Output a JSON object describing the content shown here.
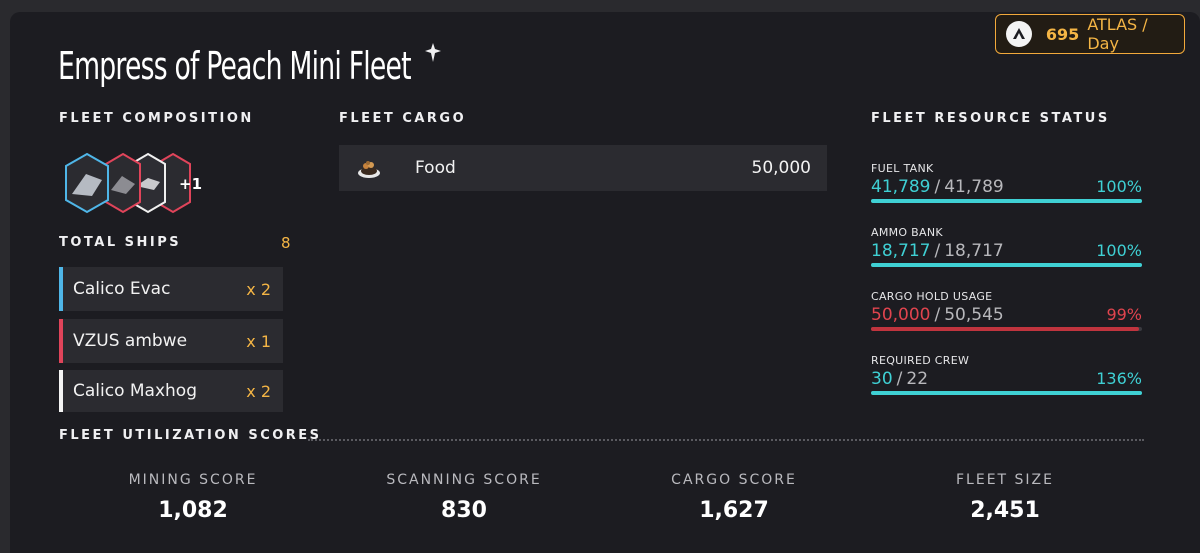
{
  "header": {
    "title": "Empress of Peach Mini Fleet",
    "atlas_value": "695",
    "atlas_unit": "ATLAS / Day"
  },
  "composition": {
    "label": "FLEET COMPOSITION",
    "extra_count": "+1",
    "total_label": "TOTAL SHIPS",
    "total_value": "8",
    "ships": [
      {
        "name": "Calico Evac",
        "qty": "x 2",
        "color": "#4fb6e8"
      },
      {
        "name": "VZUS ambwe",
        "qty": "x 1",
        "color": "#e0445a"
      },
      {
        "name": "Calico Maxhog",
        "qty": "x 2",
        "color": "#f4f4f4"
      }
    ]
  },
  "cargo": {
    "label": "FLEET CARGO",
    "items": [
      {
        "name": "Food",
        "amount": "50,000",
        "icon": "food-bowl-icon"
      }
    ]
  },
  "resources": {
    "label": "FLEET RESOURCE STATUS",
    "items": [
      {
        "label": "FUEL TANK",
        "current": "41,789",
        "max": "41,789",
        "pct": "100%",
        "level": 1.0,
        "color": "#3fd0d4"
      },
      {
        "label": "AMMO BANK",
        "current": "18,717",
        "max": "18,717",
        "pct": "100%",
        "level": 1.0,
        "color": "#3fd0d4"
      },
      {
        "label": "CARGO HOLD USAGE",
        "current": "50,000",
        "max": "50,545",
        "pct": "99%",
        "level": 0.99,
        "color": "#e0444e"
      },
      {
        "label": "REQUIRED CREW",
        "current": "30",
        "max": "22",
        "pct": "136%",
        "level": 1.0,
        "color": "#3fd0d4"
      }
    ]
  },
  "utilization": {
    "label": "FLEET UTILIZATION SCORES",
    "scores": [
      {
        "label": "MINING SCORE",
        "value": "1,082"
      },
      {
        "label": "SCANNING SCORE",
        "value": "830"
      },
      {
        "label": "CARGO SCORE",
        "value": "1,627"
      },
      {
        "label": "FLEET SIZE",
        "value": "2,451"
      }
    ]
  },
  "colors": {
    "accent_gold": "#f4b545",
    "status_teal": "#3fd0d4",
    "status_red": "#e0444e"
  }
}
